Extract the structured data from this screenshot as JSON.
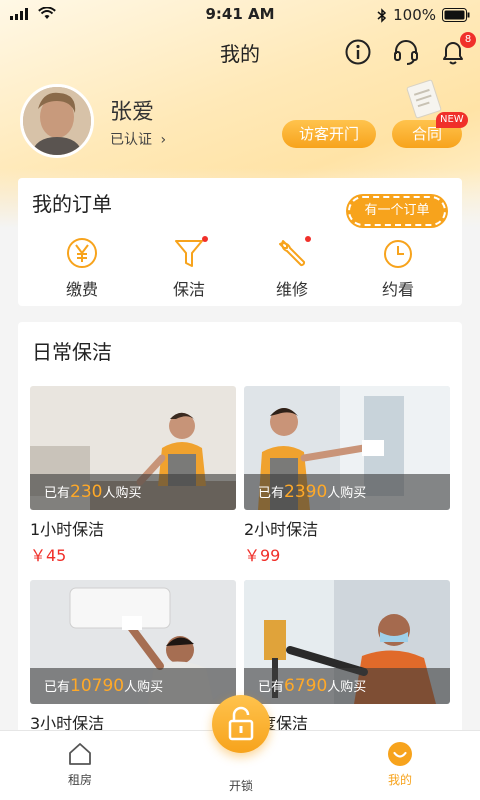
{
  "status_bar": {
    "time": "9:41 AM",
    "battery": "100%"
  },
  "navbar": {
    "title": "我的",
    "notification_count": "8"
  },
  "profile": {
    "name": "张爱",
    "verified_label": "已认证",
    "chevron": "›",
    "visitor_button": "访客开门",
    "contract_button": "合同",
    "new_tag": "NEW"
  },
  "orders": {
    "title": "我的订单",
    "tip": "有一个订单",
    "items": [
      {
        "label": "缴费",
        "icon": "yen-icon"
      },
      {
        "label": "保洁",
        "icon": "funnel-icon"
      },
      {
        "label": "维修",
        "icon": "wrench-icon"
      },
      {
        "label": "约看",
        "icon": "clock-icon"
      }
    ]
  },
  "cleaning": {
    "title": "日常保洁",
    "prefix": "已有",
    "suffix": "人购买",
    "products": [
      {
        "name": "1小时保洁",
        "price": "￥45",
        "buyers": "230"
      },
      {
        "name": "2小时保洁",
        "price": "￥99",
        "buyers": "2390"
      },
      {
        "name": "3小时保洁",
        "buyers": "10790"
      },
      {
        "name": "深度保洁",
        "buyers": "6790"
      }
    ]
  },
  "tabbar": {
    "rent": "租房",
    "unlock": "开锁",
    "mine": "我的"
  },
  "colors": {
    "accent": "#f7a31c",
    "price": "#f0302a",
    "badge": "#f0302a"
  }
}
